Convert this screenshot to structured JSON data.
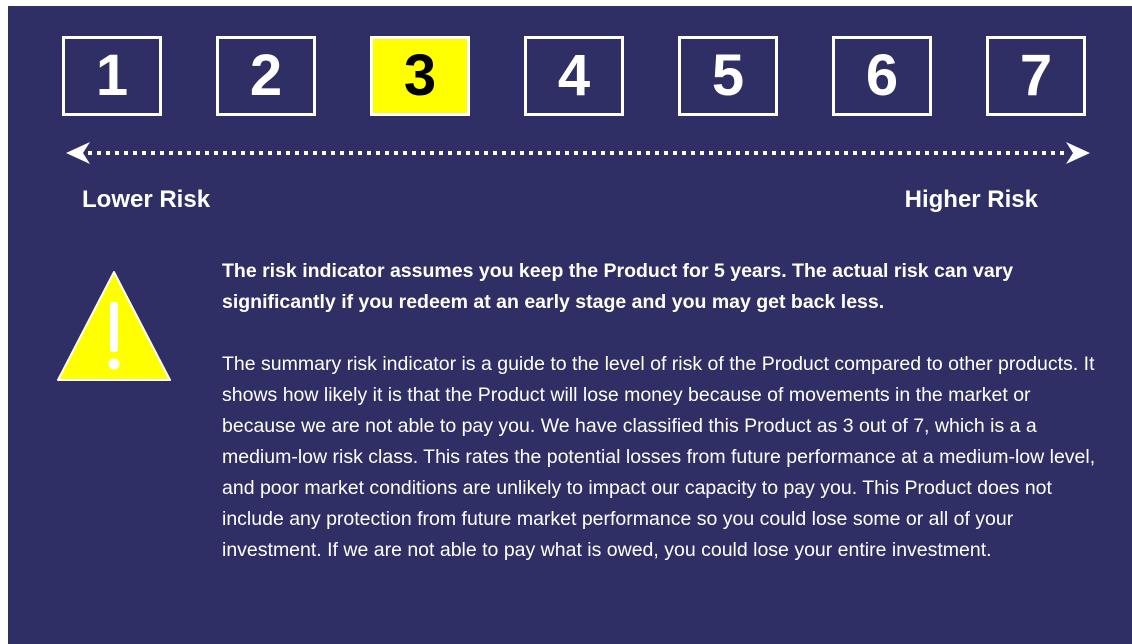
{
  "risk_scale": {
    "levels": [
      "1",
      "2",
      "3",
      "4",
      "5",
      "6",
      "7"
    ],
    "selected": "3",
    "highlight_color": "#ffff00",
    "background_color": "#2f2f66"
  },
  "labels": {
    "lower": "Lower Risk",
    "higher": "Higher Risk"
  },
  "icons": {
    "arrow": "double-headed-dotted-arrow-icon",
    "warning": "warning-triangle-icon"
  },
  "text": {
    "emphasis": "The risk indicator assumes you keep the Product for 5 years. The actual risk can vary significantly if you redeem at an early stage and you may get back less.",
    "summary": "The summary risk indicator is a guide to the level of risk of the Product compared to other products. It shows how likely it is that the Product will lose money because of movements in the market or because we are not able to pay you.  We have classified this Product as 3 out of 7, which is a a medium-low risk class. This rates the potential losses from future performance at a medium-low level, and poor market conditions are unlikely to impact our capacity to pay you. This Product does not include any protection from future market performance so you could lose some or all of your investment. If we are not able to pay what is owed, you could lose your entire investment."
  }
}
